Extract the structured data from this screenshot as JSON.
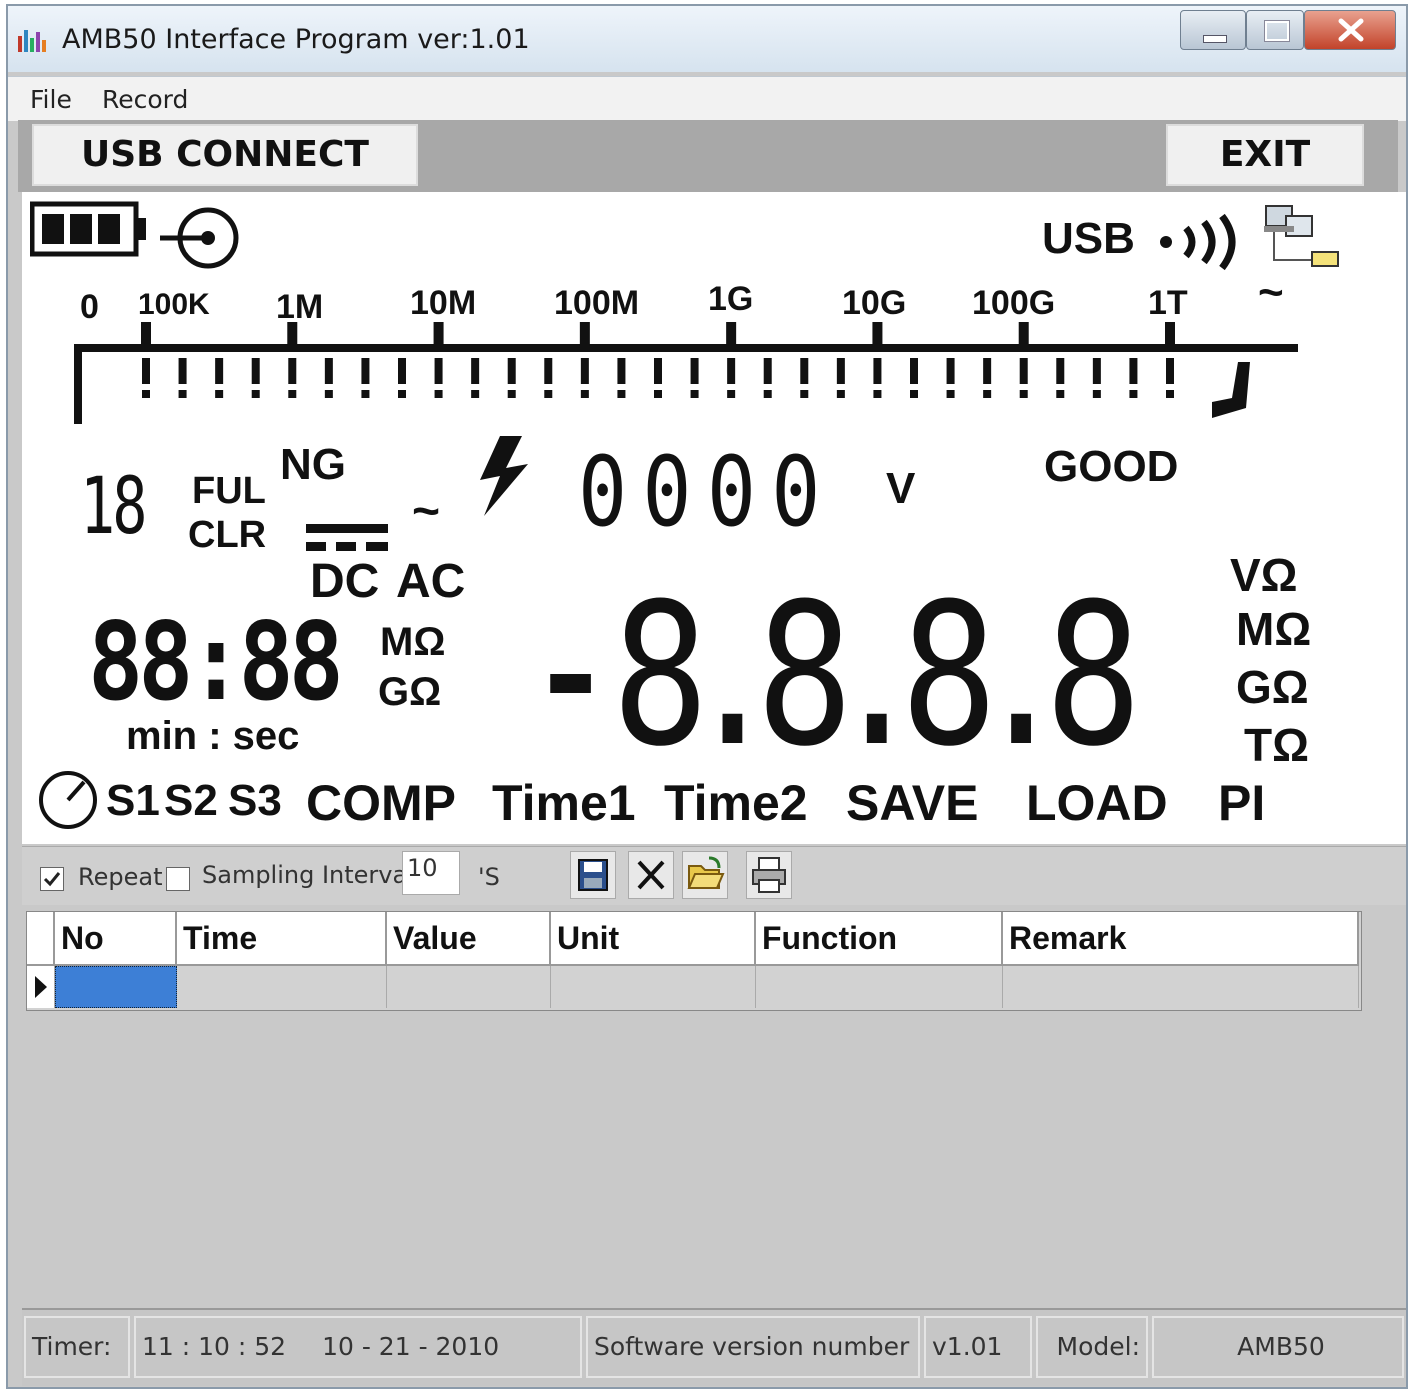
{
  "window": {
    "title": "AMB50 Interface Program ver:1.01"
  },
  "menu": [
    "File",
    "Record"
  ],
  "buttons": {
    "connect": "USB CONNECT",
    "exit": "EXIT"
  },
  "lcd": {
    "usb_label": "USB",
    "scale_labels": [
      "0",
      "100K",
      "1M",
      "10M",
      "100M",
      "1G",
      "10G",
      "100G",
      "1T",
      "~"
    ],
    "small_digits": "18",
    "ful": "FUL",
    "clr": "CLR",
    "ng": "NG",
    "tilde": "~",
    "dc": "DC",
    "ac": "AC",
    "voltage_digits": "0000",
    "voltage_unit": "V",
    "good": "GOOD",
    "timer_digits": "88:88",
    "timer_units_label": "min : sec",
    "timer_mohm": "MΩ",
    "timer_gohm": "GΩ",
    "main_sign": "-",
    "main_digits": "8.8.8.8",
    "units": [
      "VΩ",
      "MΩ",
      "GΩ",
      "TΩ"
    ],
    "bottom_labels": [
      "S1",
      "S2",
      "S3",
      "COMP",
      "Time1",
      "Time2",
      "SAVE",
      "LOAD",
      "PI"
    ]
  },
  "toolbar": {
    "repeat_label": "Repeat",
    "repeat_checked": true,
    "sampling_label": "Sampling Interval",
    "sampling_checked": false,
    "interval_value": "10",
    "interval_unit": "'S",
    "icons": [
      "save-icon",
      "delete-icon",
      "open-folder-icon",
      "print-icon"
    ]
  },
  "table": {
    "columns": [
      "No",
      "Time",
      "Value",
      "Unit",
      "Function",
      "Remark"
    ],
    "rows": [
      [
        "",
        "",
        "",
        "",
        "",
        ""
      ]
    ]
  },
  "status": {
    "timer_label": "Timer:",
    "time": "11 : 10 : 52",
    "date": "10 - 21 - 2010",
    "software_label": "Software version number :",
    "software_version": "v1.01",
    "model_label": "Model:",
    "model_value": "AMB50"
  },
  "colors": {
    "lcd_bg": "#ffffff",
    "panel_gray": "#a8a8a8",
    "selected_cell": "#3d7fd6"
  }
}
